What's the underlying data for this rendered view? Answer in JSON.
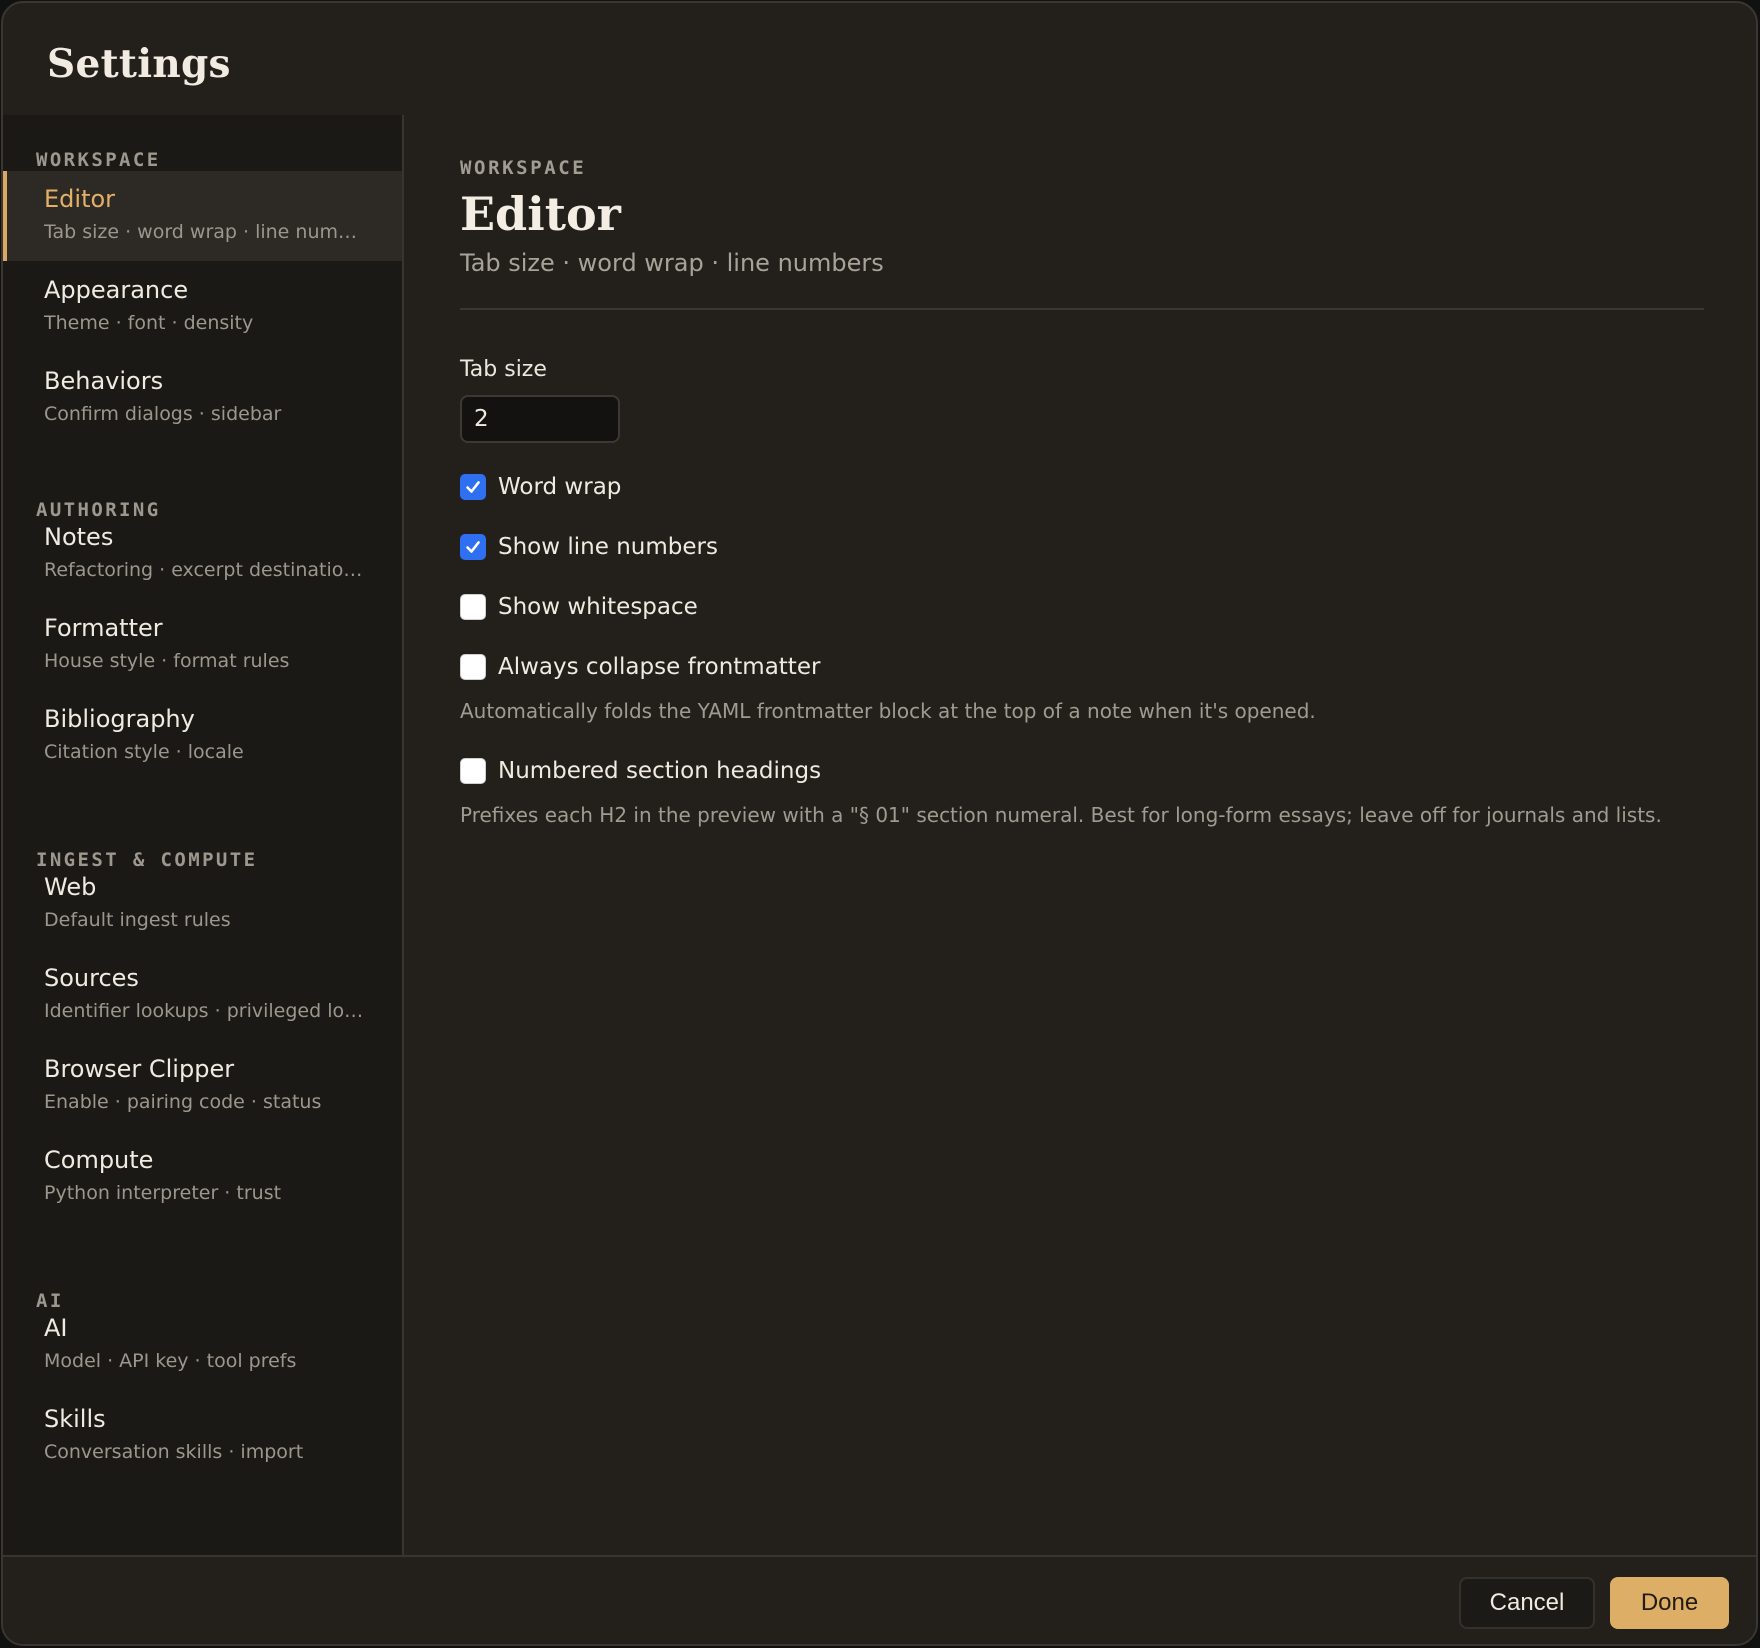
{
  "dialog": {
    "title": "Settings"
  },
  "sidebar": {
    "groups": [
      {
        "label": "WORKSPACE",
        "items": [
          {
            "title": "Editor",
            "subtitle": "Tab size · word wrap · line numbers",
            "active": true
          },
          {
            "title": "Appearance",
            "subtitle": "Theme · font · density"
          },
          {
            "title": "Behaviors",
            "subtitle": "Confirm dialogs · sidebar"
          }
        ]
      },
      {
        "label": "AUTHORING",
        "items": [
          {
            "title": "Notes",
            "subtitle": "Refactoring · excerpt destinations"
          },
          {
            "title": "Formatter",
            "subtitle": "House style · format rules"
          },
          {
            "title": "Bibliography",
            "subtitle": "Citation style · locale"
          }
        ]
      },
      {
        "label": "INGEST & COMPUTE",
        "items": [
          {
            "title": "Web",
            "subtitle": "Default ingest rules"
          },
          {
            "title": "Sources",
            "subtitle": "Identifier lookups · privileged lookups"
          },
          {
            "title": "Browser Clipper",
            "subtitle": "Enable · pairing code · status"
          },
          {
            "title": "Compute",
            "subtitle": "Python interpreter · trust"
          }
        ]
      },
      {
        "label": "AI",
        "items": [
          {
            "title": "AI",
            "subtitle": "Model · API key · tool prefs"
          },
          {
            "title": "Skills",
            "subtitle": "Conversation skills · import"
          }
        ]
      }
    ]
  },
  "main": {
    "kicker": "WORKSPACE",
    "title": "Editor",
    "subtitle": "Tab size · word wrap · line numbers",
    "tab_size": {
      "label": "Tab size",
      "value": "2"
    },
    "options": [
      {
        "label": "Word wrap",
        "checked": true
      },
      {
        "label": "Show line numbers",
        "checked": true
      },
      {
        "label": "Show whitespace",
        "checked": false
      },
      {
        "label": "Always collapse frontmatter",
        "checked": false,
        "help": "Automatically folds the YAML frontmatter block at the top of a note when it's opened."
      },
      {
        "label": "Numbered section headings",
        "checked": false,
        "help": "Prefixes each H2 in the preview with a \"§ 01\" section numeral. Best for long-form essays; leave off for journals and lists."
      }
    ]
  },
  "footer": {
    "cancel_label": "Cancel",
    "done_label": "Done"
  },
  "colors": {
    "accent": "#dcae66",
    "checkbox_checked": "#2f6ff2",
    "background": "#23201c",
    "sidebar": "#1b1916"
  }
}
